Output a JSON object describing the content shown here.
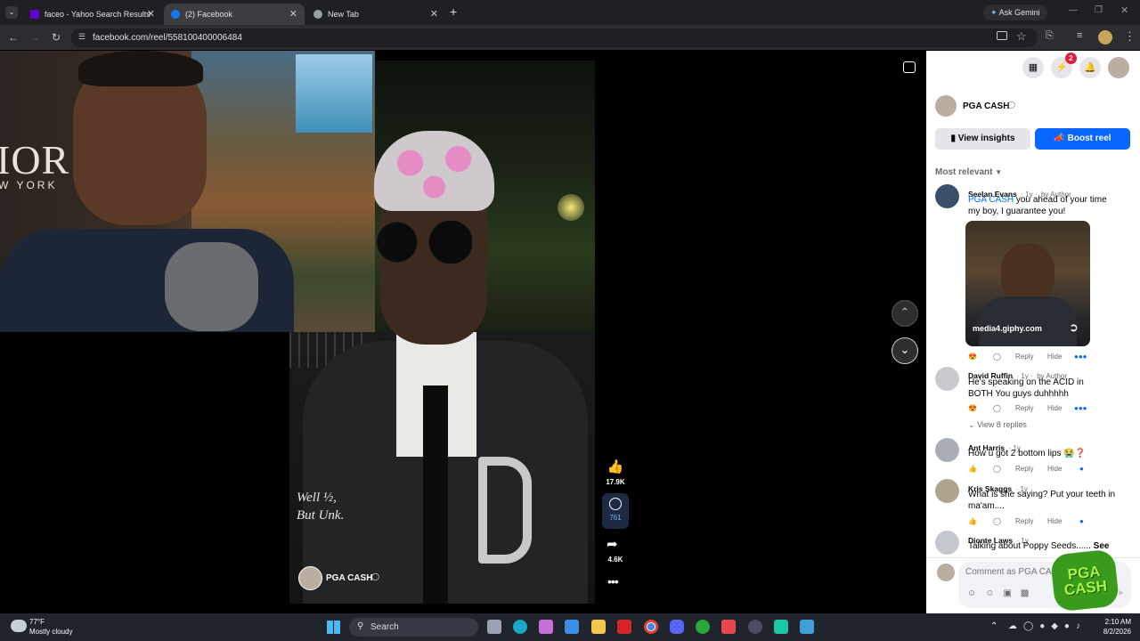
{
  "tabs": [
    {
      "title": "faceo - Yahoo Search Results",
      "icon": "yahoo-icon",
      "color": "#5f01d1"
    },
    {
      "title": "(2) Facebook",
      "icon": "facebook-icon",
      "color": "#1877f2"
    },
    {
      "title": "New Tab",
      "icon": "globe-icon",
      "color": "#9aa0a6"
    }
  ],
  "browser": {
    "url": "facebook.com/reel/558100400006484",
    "ask_gemini": "Ask Gemini"
  },
  "reel": {
    "overlay_text": "Well ½,\nBut Unk.",
    "author": "PGA CASH",
    "likes": "17.9K",
    "comments": "761",
    "shares": "4.6K",
    "bg_text_1": "IOR",
    "bg_text_2": "W YORK"
  },
  "header": {
    "messenger_badge": "2"
  },
  "page": {
    "name": "PGA CASH",
    "view_insights": "View insights",
    "boost_reel": "Boost reel",
    "sort": "Most relevant"
  },
  "comments": [
    {
      "name": "Seelan Evans",
      "meta": "· 1y ·",
      "badge": "by Author",
      "mention": "PGA CASH",
      "text": " you ahead of your time my boy, I guarantee you!",
      "gif_source": "media4.giphy.com",
      "reply": "Reply",
      "hide": "Hide"
    },
    {
      "name": "David Ruffin",
      "meta": "· 1y ·",
      "badge": "by Author",
      "text": "He's speaking on the ACID in BOTH You guys duhhhhh",
      "reply": "Reply",
      "hide": "Hide",
      "view_replies": "View 8 replies"
    },
    {
      "name": "Ant Harris",
      "meta": "· 1y",
      "text": "How u got 2 bottom lips 😭❓",
      "reply": "Reply",
      "hide": "Hide"
    },
    {
      "name": "Kris Skaggs",
      "meta": "· 1y",
      "text": "What is she saying? Put your teeth in ma'am....",
      "reply": "Reply",
      "hide": "Hide"
    },
    {
      "name": "Dionte Laws",
      "meta": "· 1y",
      "text": "Talking about Poppy Seeds......",
      "see_more": "See"
    }
  ],
  "composer": {
    "placeholder": "Comment as PGA CASH",
    "sticker_text": "PGA CASH"
  },
  "taskbar": {
    "temp": "77°F",
    "weather": "Mostly cloudy",
    "search": "Search",
    "time": "2:10 AM",
    "date": "8/2/2026"
  },
  "colors": {
    "fb_blue": "#0866ff",
    "chrome_dark": "#1f2023",
    "taskbar": "#20242c"
  }
}
